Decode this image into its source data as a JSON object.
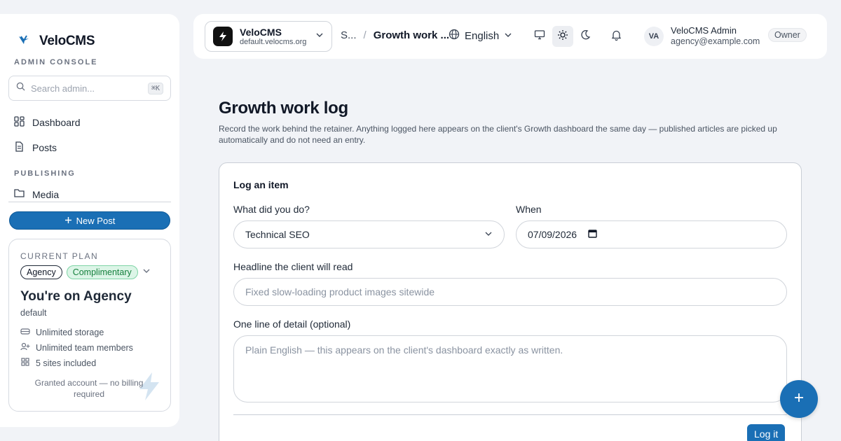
{
  "sidebar": {
    "brand": "VeloCMS",
    "console_label": "ADMIN CONSOLE",
    "search_placeholder": "Search admin...",
    "search_shortcut": "⌘K",
    "nav": [
      {
        "label": "Dashboard",
        "icon": "dashboard-grid-icon"
      },
      {
        "label": "Posts",
        "icon": "document-icon"
      }
    ],
    "section_publishing": "PUBLISHING",
    "media_label": "Media",
    "new_post_label": "New Post",
    "plan": {
      "label": "CURRENT PLAN",
      "tier_badge": "Agency",
      "status_badge": "Complimentary",
      "title": "You're on Agency",
      "subtitle": "default",
      "features": [
        "Unlimited storage",
        "Unlimited team members",
        "5 sites included"
      ],
      "note": "Granted account — no billing required"
    }
  },
  "topbar": {
    "site_name": "VeloCMS",
    "site_domain": "default.velocms.org",
    "breadcrumb_parent": "S...",
    "breadcrumb_current": "Growth work ...",
    "language": "English",
    "user_initials": "VA",
    "user_name": "VeloCMS Admin",
    "user_email": "agency@example.com",
    "role": "Owner"
  },
  "main": {
    "title": "Growth work log",
    "description": "Record the work behind the retainer. Anything logged here appears on the client's Growth dashboard the same day — published articles are picked up automatically and do not need an entry.",
    "form": {
      "title": "Log an item",
      "what_label": "What did you do?",
      "what_value": "Technical SEO",
      "when_label": "When",
      "when_value": "07/09/2026",
      "headline_label": "Headline the client will read",
      "headline_placeholder": "Fixed slow-loading product images sitewide",
      "detail_label": "One line of detail (optional)",
      "detail_placeholder": "Plain English — this appears on the client's dashboard exactly as written.",
      "submit_label": "Log it"
    }
  },
  "colors": {
    "accent": "#1a6fb5",
    "page_bg": "#f1f3f7",
    "complimentary_bg": "#dcf5e7"
  }
}
